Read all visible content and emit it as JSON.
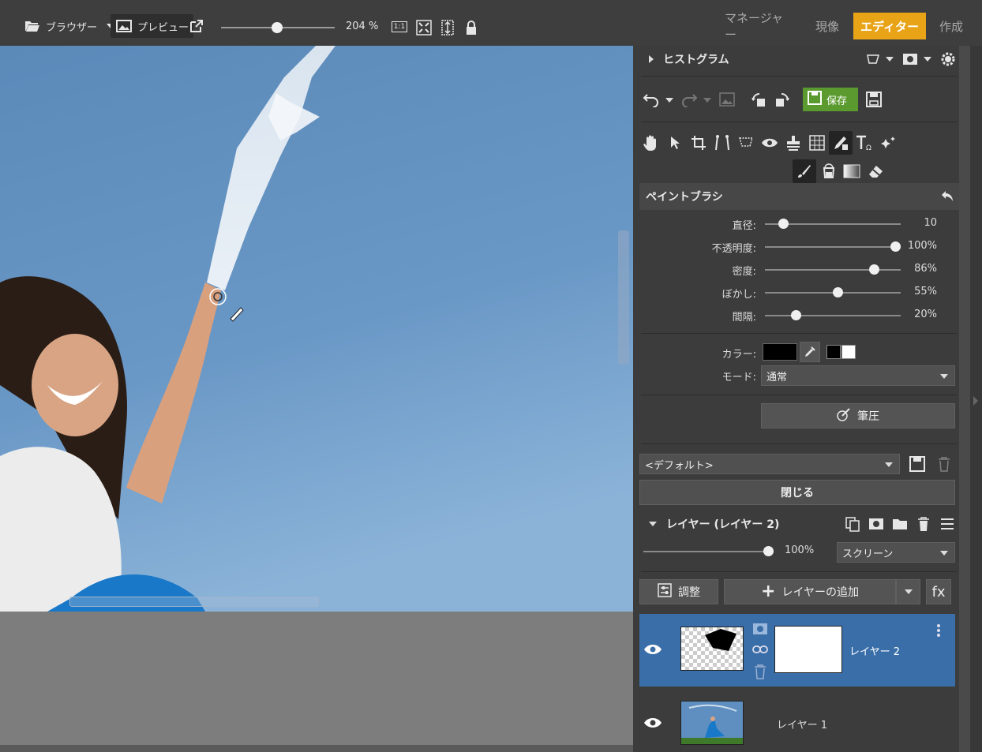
{
  "topbar": {
    "browser_label": "ブラウザー",
    "preview_label": "プレビュー",
    "zoom_value": "204 %",
    "zoom_fraction": 0.49,
    "fit_1to1": "1:1"
  },
  "modes": {
    "manager": "マネージャー",
    "develop": "現像",
    "editor": "エディター",
    "create": "作成",
    "active": "editor"
  },
  "histogram": {
    "title": "ヒストグラム"
  },
  "toolbar": {
    "save_label": "保存"
  },
  "paintbrush": {
    "title": "ペイントブラシ",
    "params": [
      {
        "label": "直径:",
        "value": "10",
        "fraction": 0.11
      },
      {
        "label": "不透明度:",
        "value": "100%",
        "fraction": 1.0
      },
      {
        "label": "密度:",
        "value": "86%",
        "fraction": 0.83
      },
      {
        "label": "ぼかし:",
        "value": "55%",
        "fraction": 0.54
      },
      {
        "label": "間隔:",
        "value": "20%",
        "fraction": 0.21
      }
    ],
    "color_label": "カラー:",
    "mode_label": "モード:",
    "mode_value": "通常",
    "pressure_label": "筆圧",
    "preset_value": "<デフォルト>",
    "close_label": "閉じる"
  },
  "layers": {
    "title": "レイヤー (レイヤー 2)",
    "opacity_value": "100%",
    "opacity_fraction": 1.0,
    "blend_mode": "スクリーン",
    "adjust_label": "調整",
    "add_layer_label": "レイヤーの追加",
    "fx_label": "fx",
    "items": [
      {
        "name": "レイヤー 2",
        "selected": true
      },
      {
        "name": "レイヤー 1",
        "selected": false
      }
    ]
  },
  "colors": {
    "accent": "#e8a317",
    "save_green": "#5a9a2e",
    "selected_layer": "#3a6ea8",
    "sky": "#5f8fc0"
  }
}
